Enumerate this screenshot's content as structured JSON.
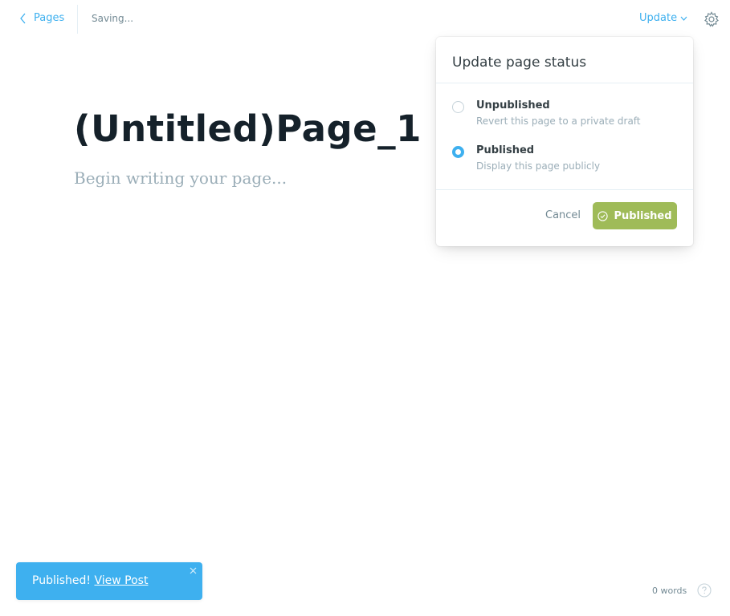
{
  "header": {
    "back_label": "Pages",
    "status": "Saving...",
    "update_label": "Update"
  },
  "editor": {
    "title": "(Untitled)Page_1",
    "body_placeholder": "Begin writing your page..."
  },
  "popover": {
    "title": "Update page status",
    "options": [
      {
        "label": "Unpublished",
        "description": "Revert this page to a private draft",
        "selected": false
      },
      {
        "label": "Published",
        "description": "Display this page publicly",
        "selected": true
      }
    ],
    "cancel_label": "Cancel",
    "confirm_label": "Published"
  },
  "toast": {
    "message": "Published!",
    "link_label": "View Post"
  },
  "footer": {
    "word_count": "0 words"
  },
  "colors": {
    "accent": "#3eb0ef",
    "published_green": "#9fbb58",
    "title_text": "#15212a",
    "muted_text": "#9baeb8"
  },
  "icons": [
    "chevron-left-icon",
    "chevron-down-icon",
    "gear-icon",
    "check-circle-icon",
    "close-icon",
    "help-icon"
  ]
}
